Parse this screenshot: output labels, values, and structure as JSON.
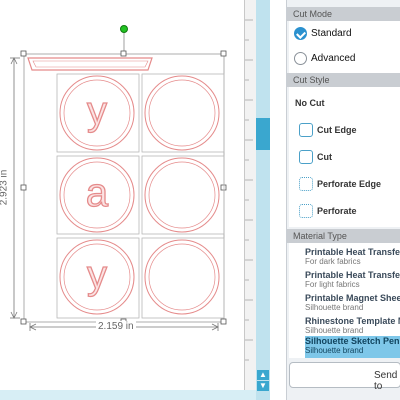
{
  "dimensions": {
    "height": "2.923 in",
    "width": "2.159 in"
  },
  "design": {
    "letters": [
      "y",
      "a",
      "y"
    ],
    "rows": 3
  },
  "panel": {
    "cut_mode": {
      "header": "Cut Mode",
      "options": [
        {
          "label": "Standard",
          "selected": true
        },
        {
          "label": "Advanced",
          "selected": false
        }
      ]
    },
    "cut_style": {
      "header": "Cut Style",
      "options": [
        {
          "label": "No Cut",
          "icon": "none"
        },
        {
          "label": "Cut Edge",
          "icon": "cut-edge-icon"
        },
        {
          "label": "Cut",
          "icon": "cut-icon"
        },
        {
          "label": "Perforate Edge",
          "icon": "perforate-edge-icon"
        },
        {
          "label": "Perforate",
          "icon": "perforate-icon"
        }
      ]
    },
    "material_type": {
      "header": "Material Type",
      "items": [
        {
          "title": "Printable Heat Transfer",
          "subtitle": "For dark fabrics",
          "selected": false
        },
        {
          "title": "Printable Heat Transfer",
          "subtitle": "For light fabrics",
          "selected": false
        },
        {
          "title": "Printable Magnet Sheet",
          "subtitle": "Silhouette brand",
          "selected": false
        },
        {
          "title": "Rhinestone Template M",
          "subtitle": "Silhouette brand",
          "selected": false
        },
        {
          "title": "Silhouette Sketch Pen",
          "subtitle": "Silhouette brand",
          "selected": true
        }
      ]
    },
    "send_button": "Send to"
  },
  "colors": {
    "accent": "#2b91cf",
    "shape": "#e58b8b",
    "handle": "#22c322"
  }
}
